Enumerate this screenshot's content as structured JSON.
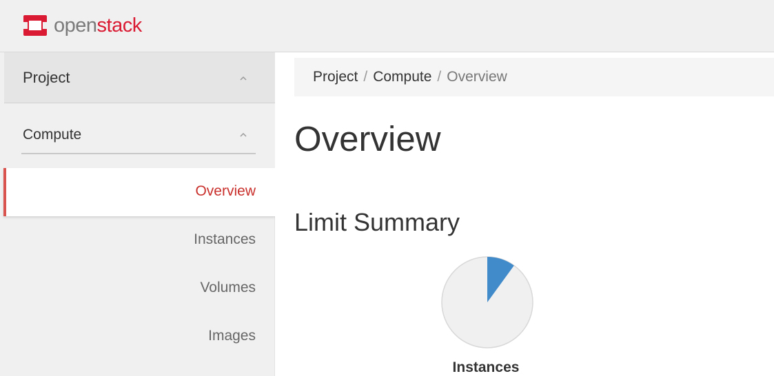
{
  "app": {
    "brand_prefix": "open",
    "brand_suffix": "stack",
    "brand_color": "#da1a32"
  },
  "sidebar": {
    "section": {
      "label": "Project",
      "icon": "chevron-up-icon"
    },
    "subsection": {
      "label": "Compute",
      "icon": "chevron-up-icon"
    },
    "items": [
      {
        "label": "Overview",
        "active": true
      },
      {
        "label": "Instances",
        "active": false
      },
      {
        "label": "Volumes",
        "active": false
      },
      {
        "label": "Images",
        "active": false
      }
    ],
    "active_color": "#c9302c"
  },
  "breadcrumb": {
    "items": [
      "Project",
      "Compute",
      "Overview"
    ],
    "separator": "/"
  },
  "main": {
    "title": "Overview",
    "section_title": "Limit Summary",
    "charts": [
      {
        "label": "Instances",
        "used_fraction": 0.1,
        "used_color": "#428bca",
        "free_color": "#f0f0f0"
      }
    ]
  }
}
